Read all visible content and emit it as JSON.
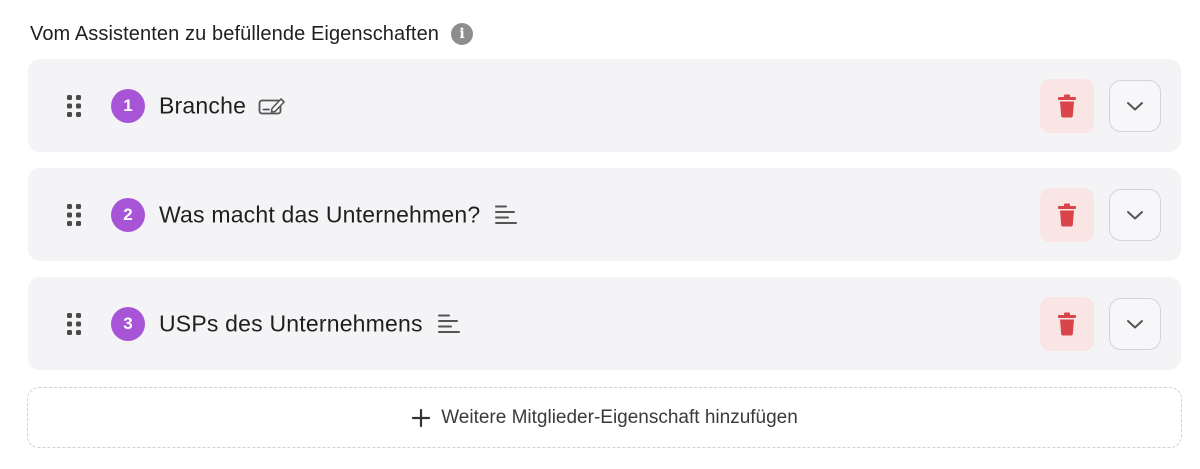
{
  "section": {
    "title": "Vom Assistenten zu befüllende Eigenschaften",
    "info_icon": "info-icon",
    "info_glyph": "i"
  },
  "properties": [
    {
      "number": "1",
      "label": "Branche",
      "type_icon": "edit-field-icon"
    },
    {
      "number": "2",
      "label": "Was macht das Unternehmen?",
      "type_icon": "text-lines-icon"
    },
    {
      "number": "3",
      "label": "USPs des Unternehmens",
      "type_icon": "text-lines-icon"
    }
  ],
  "add_button": {
    "label": "Weitere Mitglieder-Eigenschaft hinzufügen",
    "icon": "plus-icon"
  },
  "colors": {
    "badge": "#a754d6",
    "delete_bg": "#fae5e5",
    "delete_icon": "#d9454a",
    "row_bg": "#f4f4f6"
  }
}
